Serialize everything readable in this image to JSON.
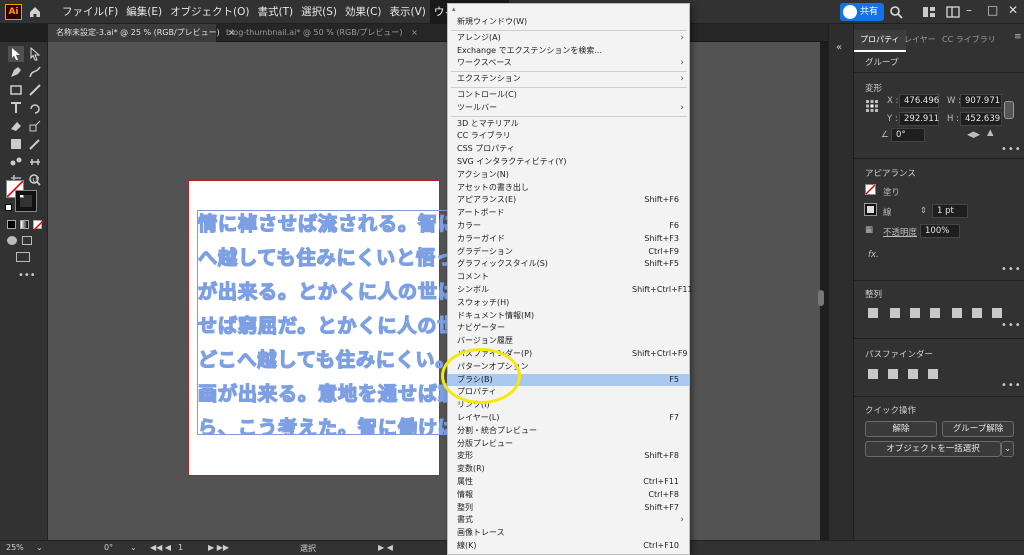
{
  "app": {
    "logo_text": "Ai"
  },
  "menubar": {
    "items": [
      "ファイル(F)",
      "編集(E)",
      "オブジェクト(O)",
      "書式(T)",
      "選択(S)",
      "効果(C)",
      "表示(V)",
      "ウィンドウ(W)"
    ],
    "active_index": 7,
    "share_label": "共有"
  },
  "tabs": [
    {
      "label": "名称未設定-3.ai* @ 25 % (RGB/プレビュー)",
      "close": "×"
    },
    {
      "label": "blog-thumbnail.ai* @ 50 % (RGB/プレビュー)",
      "close": "×"
    }
  ],
  "canvas": {
    "text_lines": [
      "情に棹させば流される。智に",
      "へ越しても住みにくいと悟っ",
      "が出来る。とかくに人の世は",
      "せば窮屈だ。とかくに人の世",
      "どこへ越しても住みにくい。",
      "画が出来る。意地を通せば窮",
      "ら、こう考えた。智に働けば"
    ]
  },
  "window_menu": {
    "items": [
      {
        "label": "新規ウィンドウ(W)",
        "shortcut": "",
        "submenu": false
      },
      {
        "label": "アレンジ(A)",
        "shortcut": "",
        "submenu": true
      },
      {
        "label": "Exchange でエクステンションを検索...",
        "shortcut": "",
        "submenu": false
      },
      {
        "label": "ワークスペース",
        "shortcut": "",
        "submenu": true
      },
      {
        "label": "エクステンション",
        "shortcut": "",
        "submenu": true
      },
      {
        "label": "コントロール(C)",
        "shortcut": "",
        "submenu": false
      },
      {
        "label": "ツールバー",
        "shortcut": "",
        "submenu": true
      },
      {
        "label": "3D とマテリアル",
        "shortcut": "",
        "submenu": false
      },
      {
        "label": "CC ライブラリ",
        "shortcut": "",
        "submenu": false
      },
      {
        "label": "CSS プロパティ",
        "shortcut": "",
        "submenu": false
      },
      {
        "label": "SVG インタラクティビティ(Y)",
        "shortcut": "",
        "submenu": false
      },
      {
        "label": "アクション(N)",
        "shortcut": "",
        "submenu": false
      },
      {
        "label": "アセットの書き出し",
        "shortcut": "",
        "submenu": false
      },
      {
        "label": "アピアランス(E)",
        "shortcut": "Shift+F6",
        "submenu": false
      },
      {
        "label": "アートボード",
        "shortcut": "",
        "submenu": false
      },
      {
        "label": "カラー",
        "shortcut": "F6",
        "submenu": false
      },
      {
        "label": "カラーガイド",
        "shortcut": "Shift+F3",
        "submenu": false
      },
      {
        "label": "グラデーション",
        "shortcut": "Ctrl+F9",
        "submenu": false
      },
      {
        "label": "グラフィックスタイル(S)",
        "shortcut": "Shift+F5",
        "submenu": false
      },
      {
        "label": "コメント",
        "shortcut": "",
        "submenu": false
      },
      {
        "label": "シンボル",
        "shortcut": "Shift+Ctrl+F11",
        "submenu": false
      },
      {
        "label": "スウォッチ(H)",
        "shortcut": "",
        "submenu": false
      },
      {
        "label": "ドキュメント情報(M)",
        "shortcut": "",
        "submenu": false
      },
      {
        "label": "ナビゲーター",
        "shortcut": "",
        "submenu": false
      },
      {
        "label": "バージョン履歴",
        "shortcut": "",
        "submenu": false
      },
      {
        "label": "パスファインダー(P)",
        "shortcut": "Shift+Ctrl+F9",
        "submenu": false
      },
      {
        "label": "パターンオプション",
        "shortcut": "",
        "submenu": false
      },
      {
        "label": "ブラシ(B)",
        "shortcut": "F5",
        "submenu": false
      },
      {
        "label": "プロパティ",
        "shortcut": "",
        "submenu": false
      },
      {
        "label": "リンク(I)",
        "shortcut": "",
        "submenu": false
      },
      {
        "label": "レイヤー(L)",
        "shortcut": "F7",
        "submenu": false
      },
      {
        "label": "分割・統合プレビュー",
        "shortcut": "",
        "submenu": false
      },
      {
        "label": "分版プレビュー",
        "shortcut": "",
        "submenu": false
      },
      {
        "label": "変形",
        "shortcut": "Shift+F8",
        "submenu": false
      },
      {
        "label": "変数(R)",
        "shortcut": "",
        "submenu": false
      },
      {
        "label": "属性",
        "shortcut": "Ctrl+F11",
        "submenu": false
      },
      {
        "label": "情報",
        "shortcut": "Ctrl+F8",
        "submenu": false
      },
      {
        "label": "整列",
        "shortcut": "Shift+F7",
        "submenu": false
      },
      {
        "label": "書式",
        "shortcut": "",
        "submenu": true
      },
      {
        "label": "画像トレース",
        "shortcut": "",
        "submenu": false
      },
      {
        "label": "線(K)",
        "shortcut": "Ctrl+F10",
        "submenu": false
      }
    ],
    "highlighted_index": 27,
    "separators_after": [
      0,
      3,
      4,
      6
    ]
  },
  "panel": {
    "tabs": [
      "プロパティ",
      "レイヤー",
      "CC ライブラリ"
    ],
    "selection": "グループ",
    "transform": {
      "title": "変形",
      "x_label": "X :",
      "x": "476.496",
      "w_label": "W :",
      "w": "907.971",
      "y_label": "Y :",
      "y": "292.911",
      "h_label": "H :",
      "h": "452.639",
      "angle": "0°"
    },
    "appearance": {
      "title": "アピアランス",
      "fill_label": "塗り",
      "stroke_label": "線",
      "stroke_value": "1 pt",
      "opacity_label": "不透明度",
      "opacity_value": "100%",
      "fx": "fx."
    },
    "align_title": "整列",
    "pathfinder_title": "パスファインダー",
    "quick_actions": {
      "title": "クイック操作",
      "release": "解除",
      "ungroup": "グループ解除",
      "recolor": "オブジェクトを一括選択"
    }
  },
  "statusbar": {
    "zoom": "25%",
    "rotation": "0°",
    "artboard": "1",
    "mode": "選択"
  },
  "colors": {
    "highlight": "#a9c9f1",
    "circle": "#f5e90a",
    "accent": "#1473e6"
  }
}
